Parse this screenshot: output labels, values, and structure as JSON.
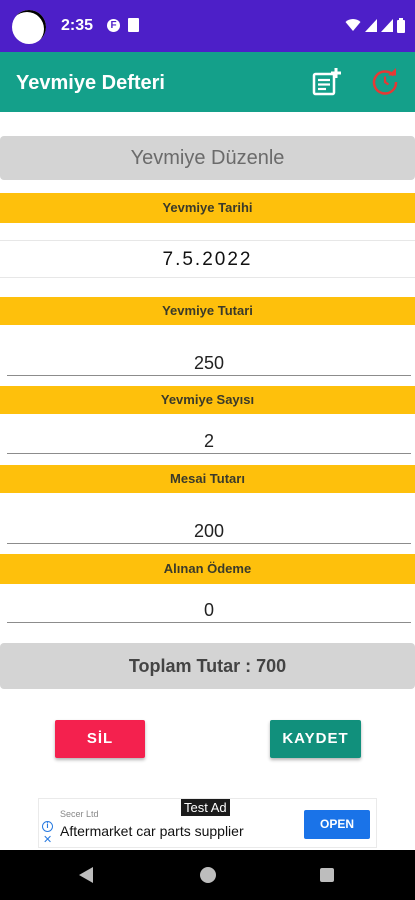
{
  "status_bar": {
    "time": "2:35",
    "notification_icons": [
      "f-icon",
      "sd-card-icon"
    ],
    "system_icons": [
      "wifi-icon",
      "signal-icon",
      "signal-icon",
      "battery-icon"
    ]
  },
  "app_bar": {
    "title": "Yevmiye Defteri",
    "actions": [
      "add-note-icon",
      "refresh-icon"
    ],
    "refresh_icon_color": "#e53935"
  },
  "form": {
    "header": "Yevmiye Düzenle",
    "date_label": "Yevmiye Tarihi",
    "date_value": "7.5.2022",
    "amount_label": "Yevmiye Tutari",
    "amount_value": "250",
    "count_label": "Yevmiye Sayısı",
    "count_value": "2",
    "overtime_label": "Mesai Tutarı",
    "overtime_value": "200",
    "received_label": "Alınan Ödeme",
    "received_value": "0",
    "total_text": "Toplam Tutar : 700"
  },
  "buttons": {
    "delete_label": "SİL",
    "save_label": "KAYDET"
  },
  "ad": {
    "badge": "Test Ad",
    "advertiser": "Secer Ltd",
    "text": "Aftermarket car parts supplier",
    "cta": "OPEN"
  },
  "colors": {
    "status_bar": "#4d1fc8",
    "app_bar": "#14a08a",
    "label_background": "#fec00c",
    "section_background": "#d4d4d4",
    "delete_button": "#f4214e",
    "save_button": "#11907c",
    "ad_button": "#1a73e8"
  }
}
